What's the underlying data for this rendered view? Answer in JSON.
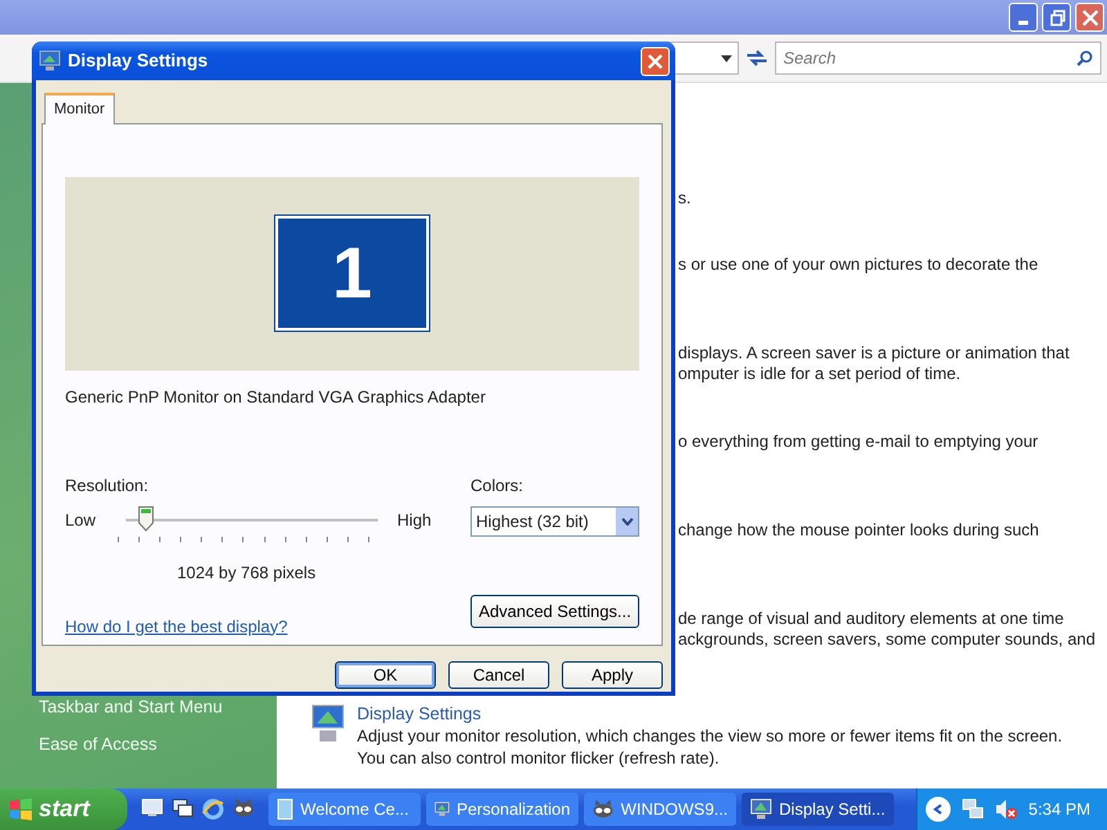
{
  "outer_window": {
    "controls": [
      {
        "kind": "minimize"
      },
      {
        "kind": "restore"
      },
      {
        "kind": "close"
      }
    ]
  },
  "toolbar": {
    "search": {
      "placeholder": "Search"
    }
  },
  "sidebar": {
    "items": [
      {
        "label": "Taskbar and Start Menu"
      },
      {
        "label": "Ease of Access"
      }
    ]
  },
  "content": {
    "sections": [
      {
        "lines": [
          "s."
        ]
      },
      {
        "lines": [
          "s or use one of your own pictures to decorate the"
        ]
      },
      {
        "lines": [
          "displays. A screen saver is a picture or animation that",
          "omputer is idle for a set period of time."
        ]
      },
      {
        "lines": [
          "o everything from getting e-mail to emptying your"
        ]
      },
      {
        "lines": [
          "change how the mouse pointer looks during such"
        ]
      },
      {
        "lines": [
          "de range of visual and auditory elements at one time",
          "ackgrounds, screen savers, some computer sounds, and"
        ]
      }
    ],
    "display_settings": {
      "title": "Display Settings",
      "lines": [
        "Adjust your monitor resolution, which changes the view so more or fewer items fit on the screen.",
        "You can also control monitor flicker (refresh rate)."
      ]
    }
  },
  "dialog": {
    "title": "Display Settings",
    "tabs": [
      {
        "label": "Monitor",
        "selected": true
      }
    ],
    "monitor_number": "1",
    "monitor_name": "Generic PnP Monitor on Standard VGA Graphics Adapter",
    "resolution": {
      "label": "Resolution:",
      "low": "Low",
      "high": "High",
      "level": 0.08,
      "reading": "1024 by 768 pixels"
    },
    "colors": {
      "label": "Colors:",
      "value": "Highest (32 bit)"
    },
    "help_link": "How do I get the best display?",
    "advanced_button": "Advanced Settings...",
    "buttons": [
      {
        "label": "OK",
        "default": true
      },
      {
        "label": "Cancel",
        "default": false
      },
      {
        "label": "Apply",
        "default": false
      }
    ]
  },
  "taskbar": {
    "start": "start",
    "quick_launch": [
      {
        "kind": "desktop"
      },
      {
        "kind": "windows"
      },
      {
        "kind": "browser"
      },
      {
        "kind": "mascot"
      }
    ],
    "tasks": [
      {
        "label": "Welcome Ce...",
        "kind": "document",
        "selected": false
      },
      {
        "label": "Personalization",
        "kind": "monitor",
        "selected": false
      },
      {
        "label": "WINDOWS9...",
        "kind": "mascot",
        "selected": false
      },
      {
        "label": "Display Setti...",
        "kind": "monitor",
        "selected": true
      }
    ],
    "clock": "5:34 PM"
  }
}
